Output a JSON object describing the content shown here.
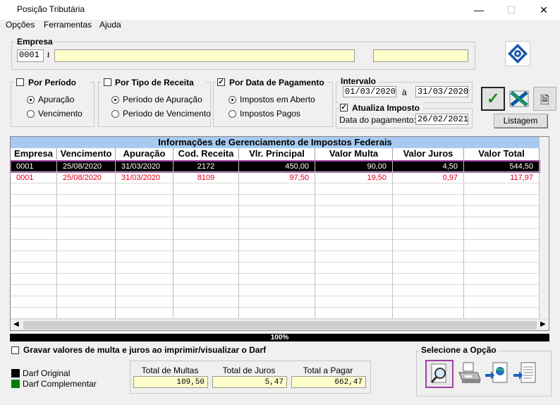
{
  "window": {
    "title": "Posição Tributária",
    "minimize": "—",
    "maximize": "☐",
    "close": "✕"
  },
  "menu": {
    "opcoes": "Opções",
    "ferramentas": "Ferramentas",
    "ajuda": "Ajuda"
  },
  "empresa": {
    "title": "Empresa",
    "code": "0001",
    "name_value": "",
    "extra_value": ""
  },
  "por_periodo": {
    "title": "Por Período",
    "checked": false,
    "options": [
      "Apuração",
      "Vencimento"
    ],
    "selected": 0
  },
  "por_tipo": {
    "title": "Por Tipo de Receita",
    "checked": false,
    "options": [
      "Período de Apuração",
      "Período de Vencimento"
    ],
    "selected": 0
  },
  "por_data": {
    "title": "Por Data de Pagamento",
    "checked": true,
    "options": [
      "Impostos em Aberto",
      "Impostos Pagos"
    ],
    "selected": 0
  },
  "intervalo": {
    "title": "Intervalo",
    "from": "01/03/2020",
    "sep": "à",
    "to": "31/03/2020"
  },
  "atualiza": {
    "title": "Atualiza Imposto",
    "checked": true,
    "label": "Data do pagamento:",
    "date": "26/02/2021"
  },
  "listagem_label": "Listagem",
  "grid": {
    "title": "Informações de Gerenciamento de Impostos Federais",
    "columns": [
      "Empresa",
      "Vencimento",
      "Apuração",
      "Cod. Receita",
      "Vlr. Principal",
      "Valor Multa",
      "Valor Juros",
      "Valor Total"
    ],
    "rows": [
      {
        "empresa": "0001",
        "vencimento": "25/08/2020",
        "apuracao": "31/03/2020",
        "cod": "2172",
        "principal": "450,00",
        "multa": "90,00",
        "juros": "4,50",
        "total": "544,50",
        "selected": true,
        "color": "#ffffff"
      },
      {
        "empresa": "0001",
        "vencimento": "25/08/2020",
        "apuracao": "31/03/2020",
        "cod": "8109",
        "principal": "97,50",
        "multa": "19,50",
        "juros": "0,97",
        "total": "117,97",
        "selected": false,
        "color": "#e0001a"
      }
    ]
  },
  "progress": {
    "label": "100%",
    "percent": 100
  },
  "gravar": {
    "label": "Gravar valores de multa e juros ao imprimir/visualizar o Darf",
    "checked": false
  },
  "legend": {
    "original": "Darf Original",
    "original_color": "#000000",
    "complementar": "Darf Complementar",
    "complementar_color": "#008000"
  },
  "totals": {
    "multas_label": "Total de Multas",
    "multas": "109,50",
    "juros_label": "Total de Juros",
    "juros": "5,47",
    "pagar_label": "Total a Pagar",
    "pagar": "662,47"
  },
  "selecione": {
    "title": "Selecione a Opção"
  },
  "colors": {
    "accent": "#a040a0",
    "grid_header": "#a6caf0",
    "yellow": "#ffffcc"
  }
}
